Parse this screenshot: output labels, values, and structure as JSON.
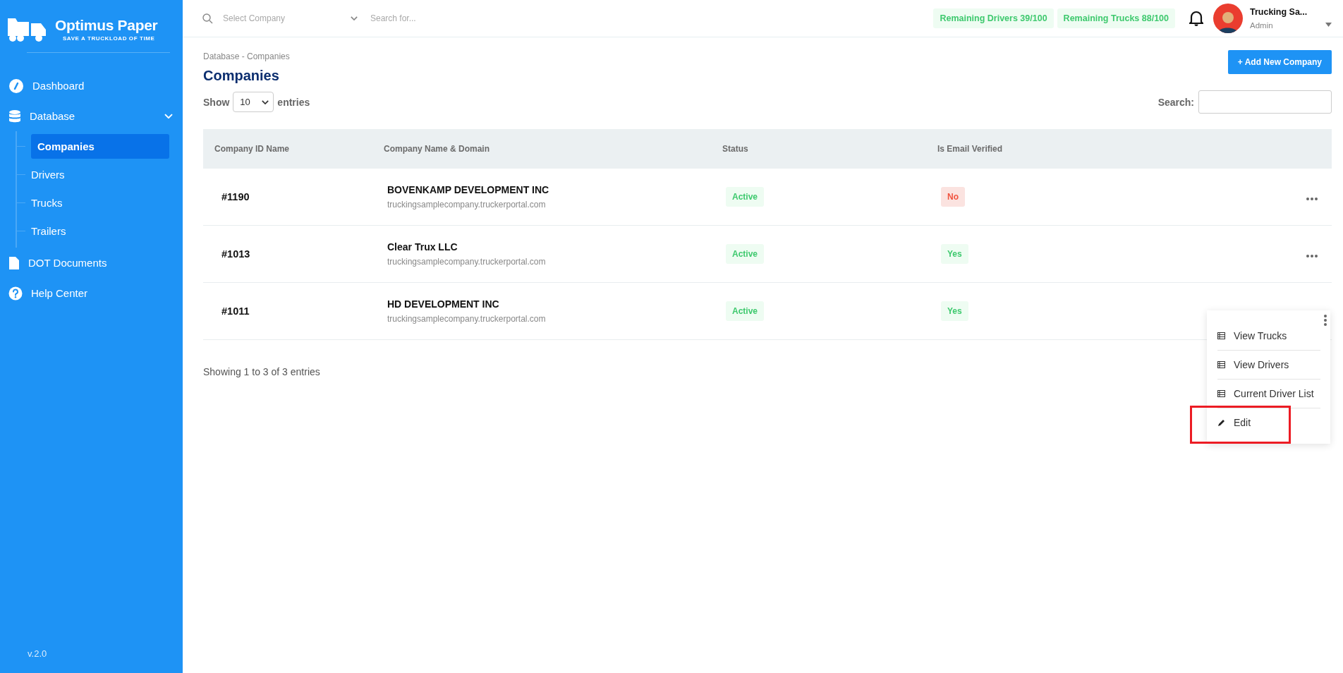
{
  "brand": {
    "name": "Optimus Paper",
    "tagline": "SAVE A TRUCKLOAD OF TIME"
  },
  "sidebar": {
    "items": [
      {
        "kind": "dashboard",
        "label": "Dashboard",
        "selected": false
      },
      {
        "kind": "database",
        "label": "Database",
        "expanded": true,
        "selected": false,
        "children": [
          {
            "label": "Companies",
            "selected": true
          },
          {
            "label": "Drivers",
            "selected": false
          },
          {
            "label": "Trucks",
            "selected": false
          },
          {
            "label": "Trailers",
            "selected": false
          }
        ]
      },
      {
        "kind": "document",
        "label": "DOT Documents",
        "selected": false
      },
      {
        "kind": "help",
        "label": "Help Center",
        "selected": false
      }
    ],
    "version": "v.2.0"
  },
  "topbar": {
    "company_select": {
      "placeholder": "Select Company"
    },
    "search": {
      "placeholder": "Search for..."
    },
    "badges": [
      "Remaining Drivers 39/100",
      "Remaining Trucks 88/100"
    ],
    "user": {
      "name": "Trucking Sa...",
      "role": "Admin"
    }
  },
  "page": {
    "breadcrumb": "Database - Companies",
    "title": "Companies",
    "add_button": "+ Add New Company",
    "show_label": "Show",
    "page_size": "10",
    "entries_label": "entries",
    "search_label": "Search:"
  },
  "table": {
    "columns": [
      "Company ID Name",
      "Company Name & Domain",
      "Status",
      "Is Email Verified"
    ],
    "rows": [
      {
        "id": "#1190",
        "name": "BOVENKAMP DEVELOPMENT INC",
        "domain": "truckingsamplecompany.truckerportal.com",
        "status": "Active",
        "verified": "No",
        "verified_ok": false,
        "menu_open": false
      },
      {
        "id": "#1013",
        "name": "Clear Trux LLC",
        "domain": "truckingsamplecompany.truckerportal.com",
        "status": "Active",
        "verified": "Yes",
        "verified_ok": true,
        "menu_open": false
      },
      {
        "id": "#1011",
        "name": "HD DEVELOPMENT INC",
        "domain": "truckingsamplecompany.truckerportal.com",
        "status": "Active",
        "verified": "Yes",
        "verified_ok": true,
        "menu_open": true
      }
    ],
    "info": "Showing 1 to 3 of 3 entries"
  },
  "row_menu": {
    "items": [
      {
        "kind": "list",
        "label": "View Trucks",
        "highlighted": false
      },
      {
        "kind": "list",
        "label": "View Drivers",
        "highlighted": false
      },
      {
        "kind": "list",
        "label": "Current Driver List",
        "highlighted": false
      },
      {
        "kind": "edit",
        "label": "Edit",
        "highlighted": true
      }
    ]
  }
}
